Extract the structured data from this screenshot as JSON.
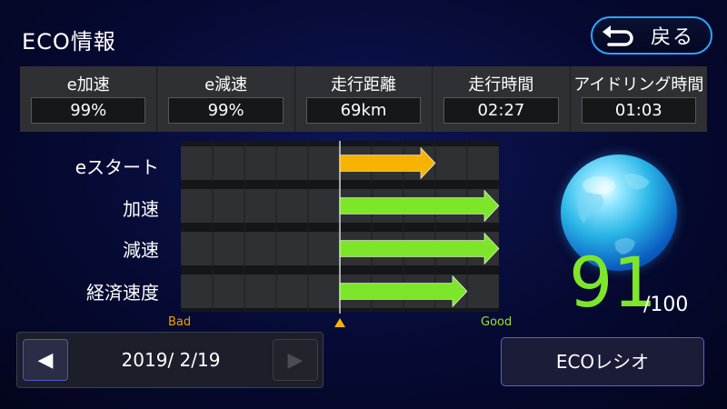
{
  "header": {
    "title": "ECO情報",
    "back_label": "戻る"
  },
  "stats": [
    {
      "label": "e加速",
      "value": "99%"
    },
    {
      "label": "e減速",
      "value": "99%"
    },
    {
      "label": "走行距離",
      "value": "69km"
    },
    {
      "label": "走行時間",
      "value": "02:27"
    },
    {
      "label": "アイドリング時間",
      "value": "01:03"
    }
  ],
  "chart_data": {
    "type": "bar",
    "categories": [
      "eスタート",
      "加速",
      "減速",
      "経済速度"
    ],
    "values": [
      60,
      100,
      100,
      80
    ],
    "ylim": [
      -100,
      100
    ],
    "scale_labels": {
      "bad": "Bad",
      "good": "Good"
    },
    "colors": {
      "eスタート": "#f6b400",
      "加速": "#7ee62a",
      "減速": "#7ee62a",
      "経済速度": "#7ee62a"
    }
  },
  "score": {
    "value": "91",
    "max": "/100"
  },
  "date_nav": {
    "date": "2019/ 2/19",
    "prev_icon": "◀",
    "next_icon": "▶"
  },
  "eco_button": {
    "label": "ECOレシオ"
  },
  "colors": {
    "accent_blue": "#2aa6ff",
    "score_green": "#7ee62a",
    "bad_orange": "#f6a000",
    "good_green": "#9be22a"
  }
}
